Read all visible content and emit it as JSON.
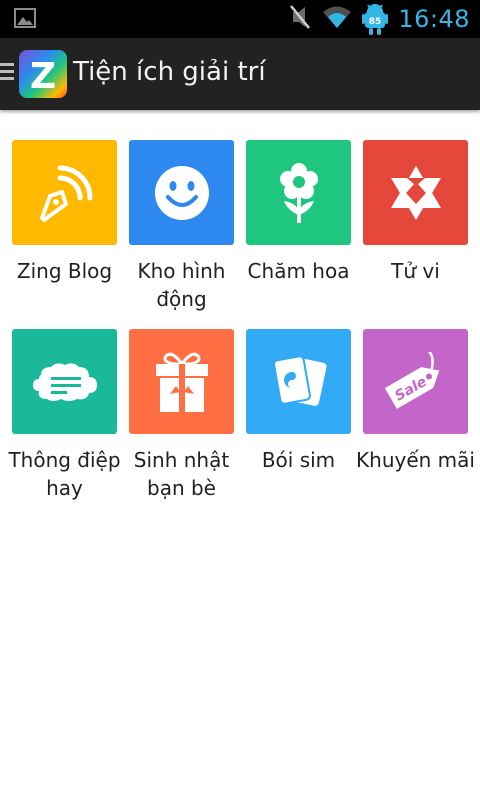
{
  "status_bar": {
    "time": "16:48",
    "battery_level": "85",
    "icons": [
      "image-notification-icon",
      "mute-icon",
      "wifi-icon",
      "android-battery-icon"
    ]
  },
  "action_bar": {
    "logo_letter": "Z",
    "title": "Tiện ích giải trí"
  },
  "tiles": [
    {
      "label": "Zing Blog",
      "color": "#ffb900",
      "icon": "pen-nib-icon"
    },
    {
      "label": "Kho hình động",
      "color": "#2d89ef",
      "icon": "smiley-icon"
    },
    {
      "label": "Chăm hoa",
      "color": "#1fc77e",
      "icon": "flower-icon"
    },
    {
      "label": "Tử vi",
      "color": "#e5483b",
      "icon": "star-of-david-icon"
    },
    {
      "label": "Thông điệp hay",
      "color": "#1ab99a",
      "icon": "cloud-message-icon"
    },
    {
      "label": "Sinh nhật bạn bè",
      "color": "#ff6f43",
      "icon": "gift-icon"
    },
    {
      "label": "Bói sim",
      "color": "#33aaf5",
      "icon": "tarot-cards-icon"
    },
    {
      "label": "Khuyến mãi",
      "color": "#c465c9",
      "icon": "sale-tag-icon"
    }
  ]
}
